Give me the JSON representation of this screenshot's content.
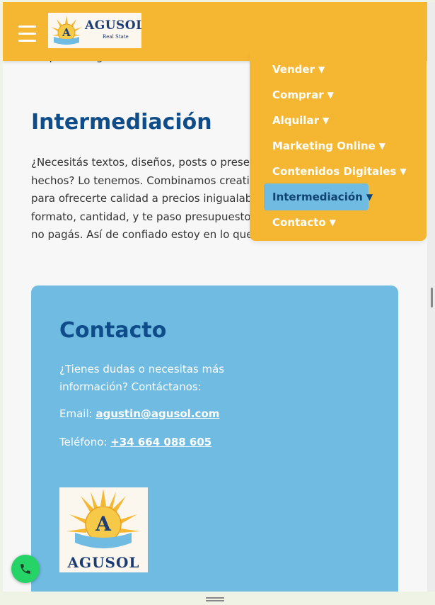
{
  "header": {
    "brand": "AGUSOL",
    "tagline": "Real State",
    "logo_letter": "A"
  },
  "intro_partial_line": "ra que tu negocio inmobiliario sea atractivo y destaque y lo que",
  "section": {
    "title": "Intermediación",
    "lines": [
      "¿Necesitás textos, diseños, posts o presentaciones",
      "hechos? Lo tenemos. Combinamos creatividad y eficiencia",
      "para ofrecerte calidad a precios inigualables. Decime el",
      "formato, cantidad, y te paso presupuesto. Si no te gusta,",
      "no pagás. Así de confiado estoy en lo que entrego."
    ]
  },
  "menu": {
    "caret": "▼",
    "items": [
      {
        "label": "Vender",
        "active": false
      },
      {
        "label": "Comprar",
        "active": false
      },
      {
        "label": "Alquilar",
        "active": false
      },
      {
        "label": "Marketing Online",
        "active": false
      },
      {
        "label": "Contenidos Digitales",
        "active": false
      },
      {
        "label": "Intermediación",
        "active": true
      },
      {
        "label": "Contacto",
        "active": false
      }
    ]
  },
  "contact": {
    "title": "Contacto",
    "intro": "¿Tienes dudas o necesitas más información? Contáctanos:",
    "email_label": "Email: ",
    "email": "agustin@agusol.com",
    "phone_label": "Teléfono: ",
    "phone": "+34 664 088 605",
    "logo_brand": "AGUSOL",
    "logo_letter": "A"
  },
  "colors": {
    "header_bg": "#f5b731",
    "title_blue": "#0e4c8a",
    "card_bg": "#6fbbe2",
    "call_green": "#25d366"
  },
  "icons": {
    "menu": "hamburger-icon",
    "call": "phone-icon"
  }
}
